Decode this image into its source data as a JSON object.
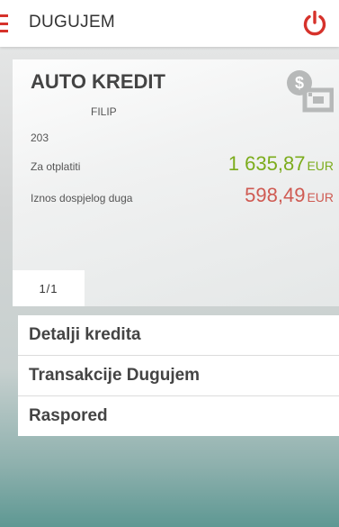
{
  "header": {
    "title": "DUGUJEM",
    "accent_color": "#d6322b"
  },
  "card": {
    "title": "AUTO KREDIT",
    "subtitle": "FILIP",
    "number": "203",
    "rows": [
      {
        "label": "Za otplatiti",
        "amount": "1 635,87",
        "currency": "EUR",
        "color": "#7cac1c"
      },
      {
        "label": "Iznos dospjelog duga",
        "amount": "598,49",
        "currency": "EUR",
        "color": "#cf5a52"
      }
    ],
    "pager": "1/1"
  },
  "menu": {
    "items": [
      {
        "label": "Detalji kredita"
      },
      {
        "label": "Transakcije Dugujem"
      },
      {
        "label": "Raspored"
      }
    ]
  }
}
